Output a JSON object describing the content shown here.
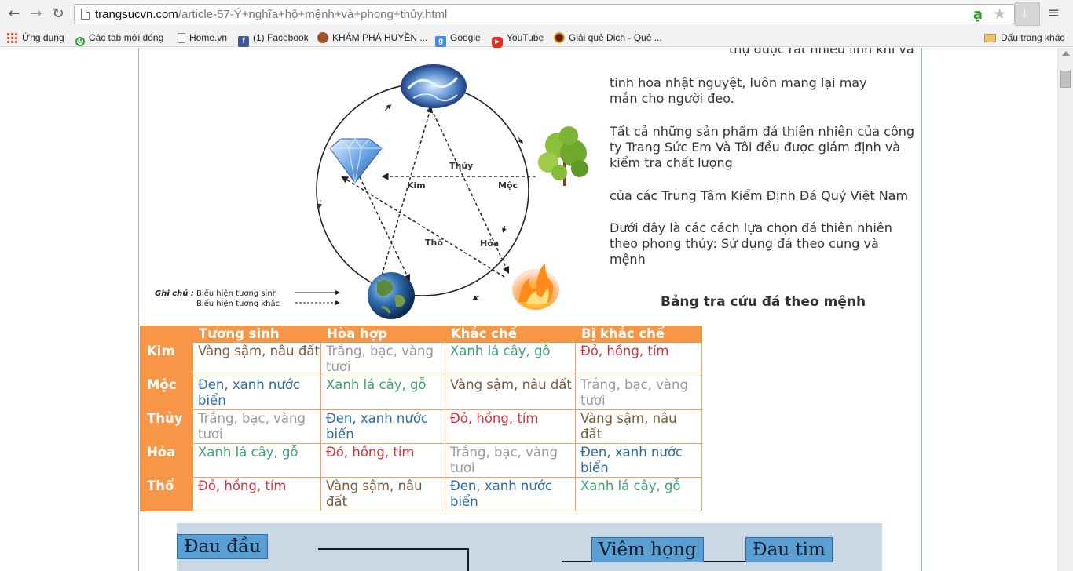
{
  "browser": {
    "url_host": "trangsucvn.com",
    "url_path": "/article-57-Ý+nghĩa+hộ+mệnh+và+phong+thủy.html",
    "nav": {
      "back": "←",
      "forward": "→",
      "reload": "↻"
    }
  },
  "bookmarks": {
    "apps": "Ứng dụng",
    "items": [
      {
        "label": "Các tab mới đóng",
        "icon": "history-icon"
      },
      {
        "label": "Home.vn",
        "icon": "page-icon"
      },
      {
        "label": "(1) Facebook",
        "icon": "facebook-icon"
      },
      {
        "label": "KHÁM PHÁ HUYỀN ...",
        "icon": "site-icon"
      },
      {
        "label": "Google",
        "icon": "google-icon"
      },
      {
        "label": "YouTube",
        "icon": "youtube-icon"
      },
      {
        "label": "Giải quẻ Dịch - Quẻ ...",
        "icon": "site-icon"
      }
    ],
    "other": "Dấu trang khác"
  },
  "diagram": {
    "elements": {
      "kim": "Kim",
      "moc": "Mộc",
      "thuy": "Thủy",
      "hoa": "Hỏa",
      "tho": "Thổ"
    },
    "legend": {
      "title": "Ghi chú :",
      "generating": "Biểu hiện tương sinh",
      "overcoming": "Biểu hiện tương khắc"
    }
  },
  "article": {
    "p0": "thụ được rất nhiều linh khí và",
    "p1": "tinh hoa nhật nguyệt, luôn mang lại may mắn cho người đeo.",
    "p2": "Tất cả những sản phẩm đá thiên nhiên của công ty Trang Sức Em Và Tôi đều được giám định và kiểm tra chất lượng",
    "p3": "của các Trung Tâm Kiểm Định Đá Quý Việt Nam",
    "p4": "Dưới đây là các cách lựa chọn đá thiên nhiên theo phong thủy: Sử dụng đá theo cung và mệnh",
    "table_title": "Bảng tra cứu đá theo mệnh"
  },
  "table": {
    "headers": [
      "",
      "Tương sinh",
      "Hòa hợp",
      "Khắc chế",
      "Bị khắc chế"
    ],
    "rows": [
      {
        "name": "Kim",
        "cells": [
          "Vàng sậm, nâu đất",
          "Trắng, bạc, vàng tươi",
          "Xanh lá cây, gỗ",
          "Đỏ, hồng, tím"
        ]
      },
      {
        "name": "Mộc",
        "cells": [
          "Đen, xanh nước biển",
          "Xanh lá cây, gỗ",
          "Vàng sậm, nâu đất",
          "Trắng, bạc, vàng tươi"
        ]
      },
      {
        "name": "Thủy",
        "cells": [
          "Trắng, bạc, vàng tươi",
          "Đen, xanh nước biển",
          "Đỏ, hồng, tím",
          "Vàng sậm, nâu đất"
        ]
      },
      {
        "name": "Hỏa",
        "cells": [
          "Xanh lá cây, gỗ",
          "Đỏ, hồng, tím",
          "Trắng, bạc, vàng tươi",
          "Đen, xanh nước biển"
        ]
      },
      {
        "name": "Thổ",
        "cells": [
          "Đỏ, hồng, tím",
          "Vàng sậm, nâu đất",
          "Đen, xanh nước biển",
          "Xanh lá cây, gỗ"
        ]
      }
    ]
  },
  "organ_chart": {
    "boxes": [
      "Đau đầu",
      "Viêm họng",
      "Đau tim"
    ]
  }
}
